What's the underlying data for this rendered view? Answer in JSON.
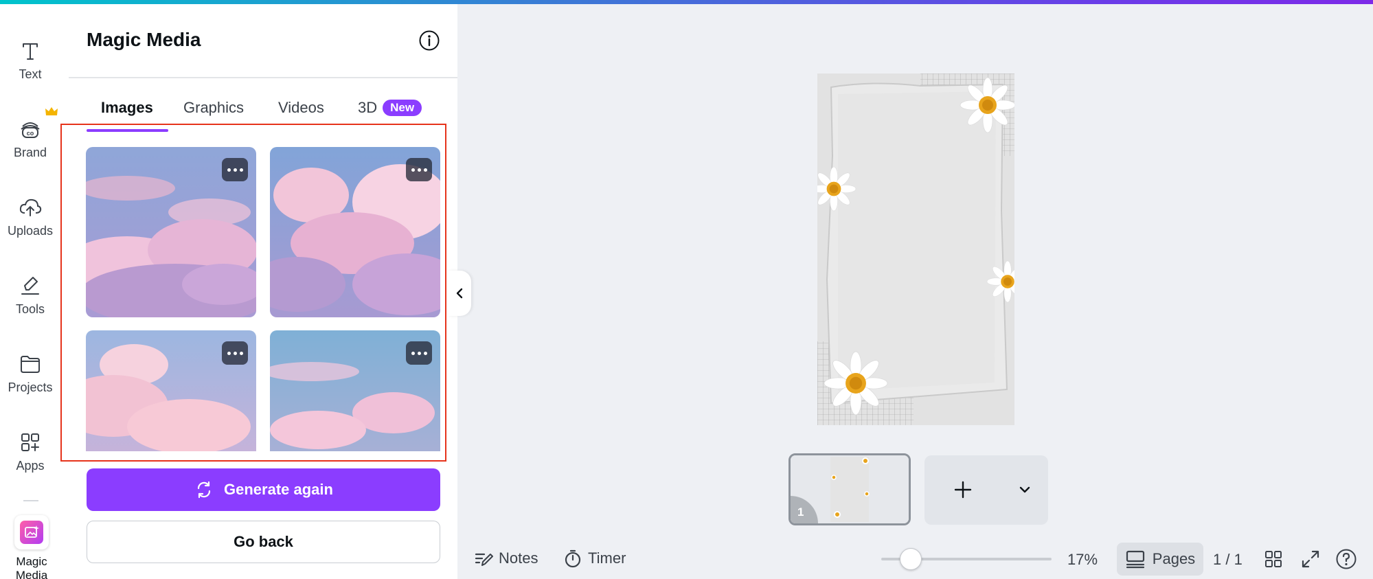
{
  "colors": {
    "accent": "#8b3dff",
    "highlight_border": "#e6331b"
  },
  "rail": {
    "items": [
      {
        "label": "Text",
        "icon": "text-icon"
      },
      {
        "label": "Brand",
        "icon": "brand-icon"
      },
      {
        "label": "Uploads",
        "icon": "cloud-upload-icon"
      },
      {
        "label": "Tools",
        "icon": "pen-tool-icon"
      },
      {
        "label": "Projects",
        "icon": "folder-icon"
      },
      {
        "label": "Apps",
        "icon": "apps-grid-icon"
      },
      {
        "label": "Magic Media",
        "icon": "magic-media-icon"
      }
    ]
  },
  "panel": {
    "title": "Magic Media",
    "tabs": [
      {
        "label": "Images",
        "active": true
      },
      {
        "label": "Graphics"
      },
      {
        "label": "Videos"
      },
      {
        "label": "3D",
        "badge": "New"
      }
    ],
    "results_count": 4,
    "generate_label": "Generate again",
    "back_label": "Go back"
  },
  "pages": {
    "current_thumb_number": "1"
  },
  "bottombar": {
    "notes_label": "Notes",
    "timer_label": "Timer",
    "zoom": "17%",
    "zoom_value": 17,
    "pages_label": "Pages",
    "page_count": "1 / 1"
  }
}
